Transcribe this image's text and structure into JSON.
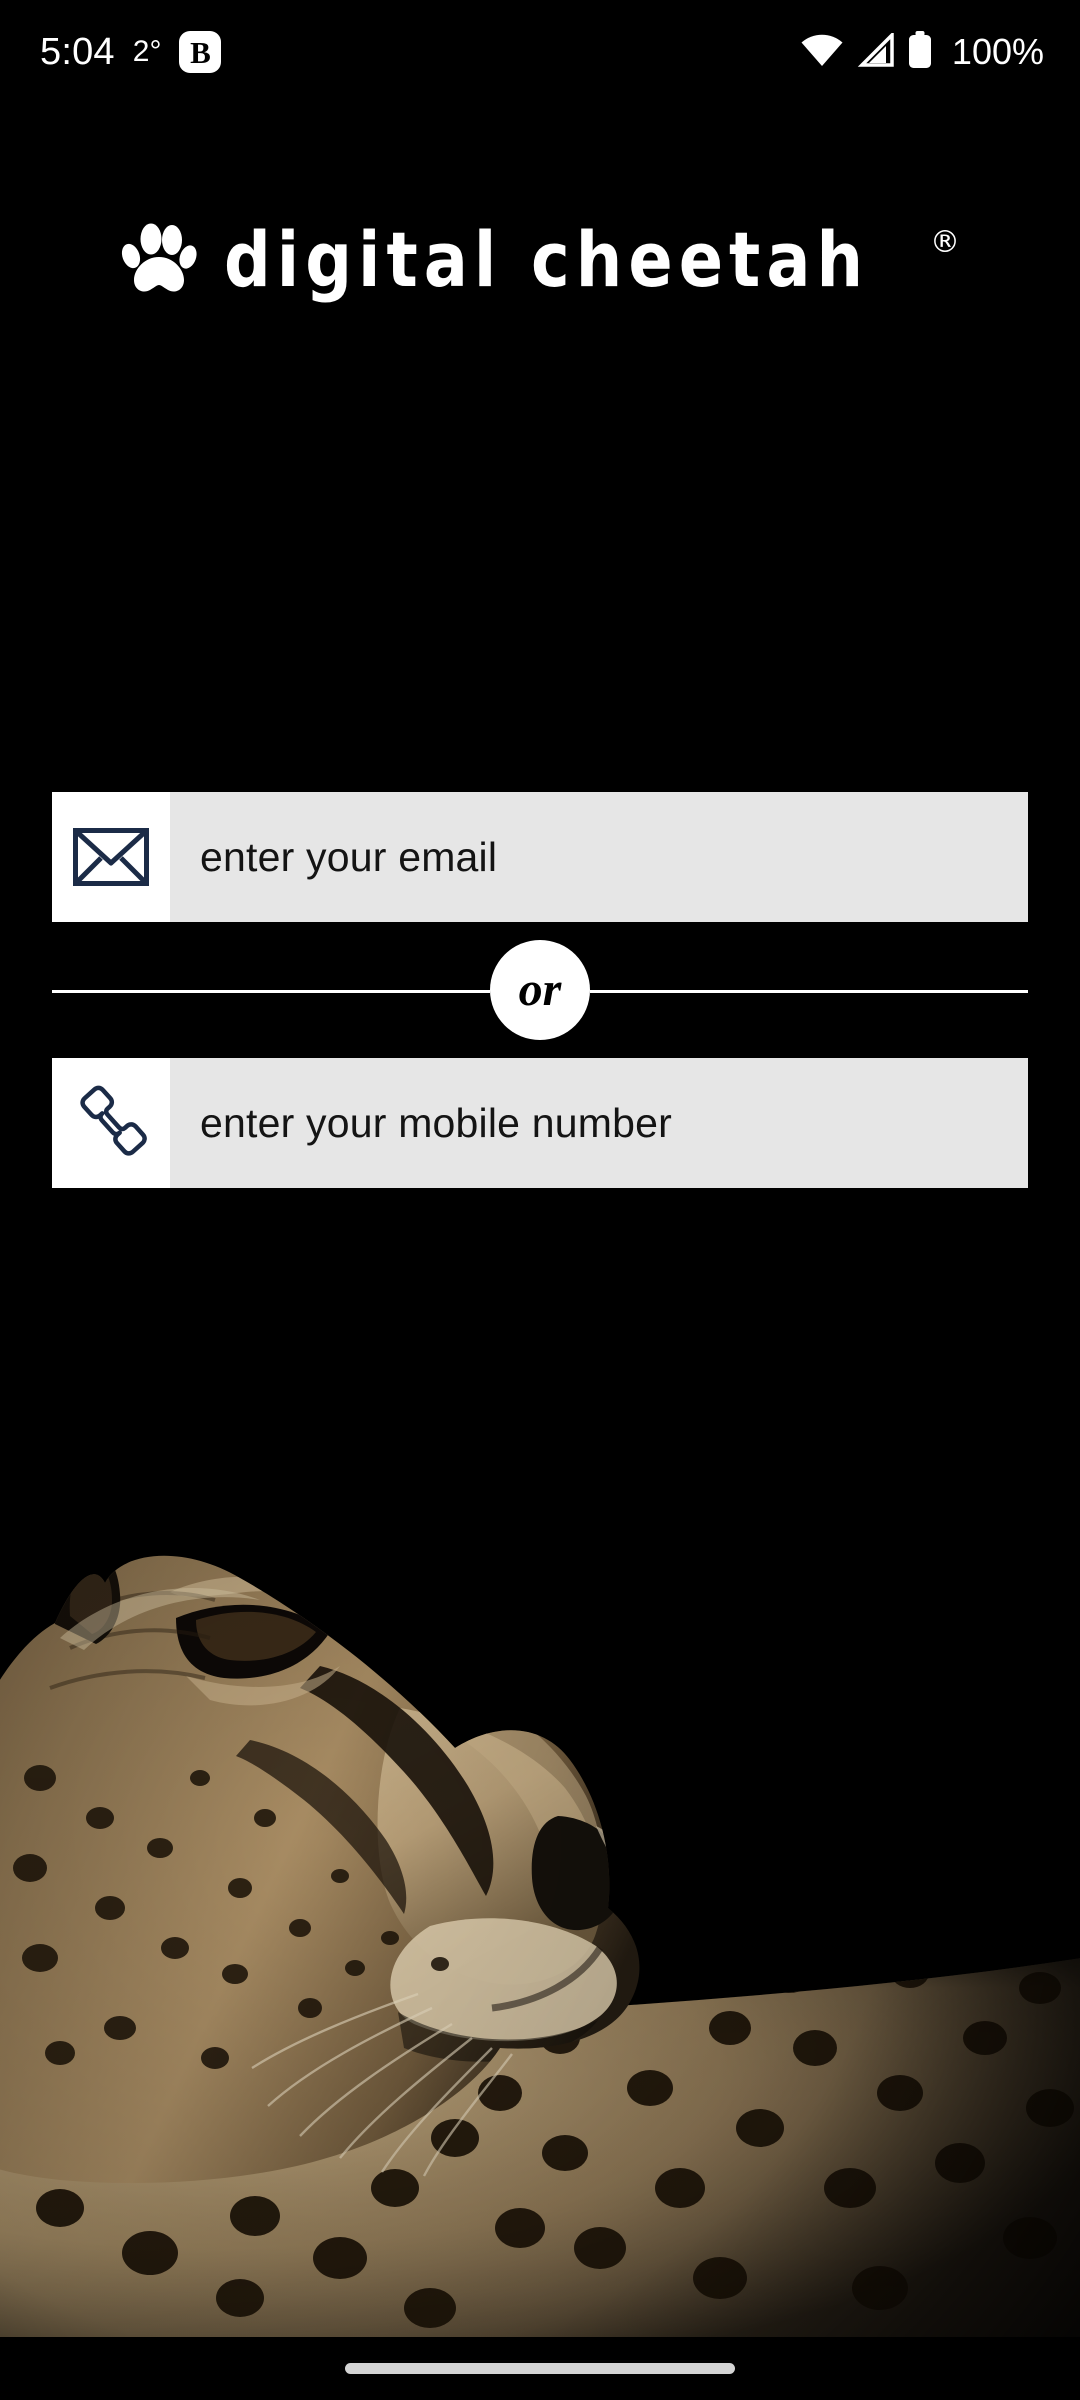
{
  "status_bar": {
    "time": "5:04",
    "temperature": "2°",
    "app_badge": "B",
    "battery_percent": "100%",
    "wifi_icon": "wifi-icon",
    "signal_icon": "cellular-signal-icon",
    "battery_icon": "battery-full-icon"
  },
  "brand": {
    "name": "digital cheetah",
    "registered_mark": "®",
    "paw_icon": "paw-print-icon"
  },
  "login_form": {
    "email": {
      "placeholder": "enter your email",
      "value": "",
      "icon": "envelope-icon"
    },
    "divider_label": "or",
    "mobile": {
      "placeholder": "enter your mobile number",
      "value": "",
      "icon": "phone-handset-icon"
    }
  },
  "hero_image": {
    "subject": "cheetah-profile-photo"
  },
  "navigation_bar": {
    "home_indicator": "home-indicator"
  },
  "colors": {
    "background": "#000000",
    "field_fill": "#e6e6e6",
    "field_icon_bg": "#ffffff",
    "icon_navy": "#1b2b47",
    "text_primary": "#ffffff",
    "placeholder_text": "#141414",
    "home_indicator": "#d4d4d4"
  }
}
